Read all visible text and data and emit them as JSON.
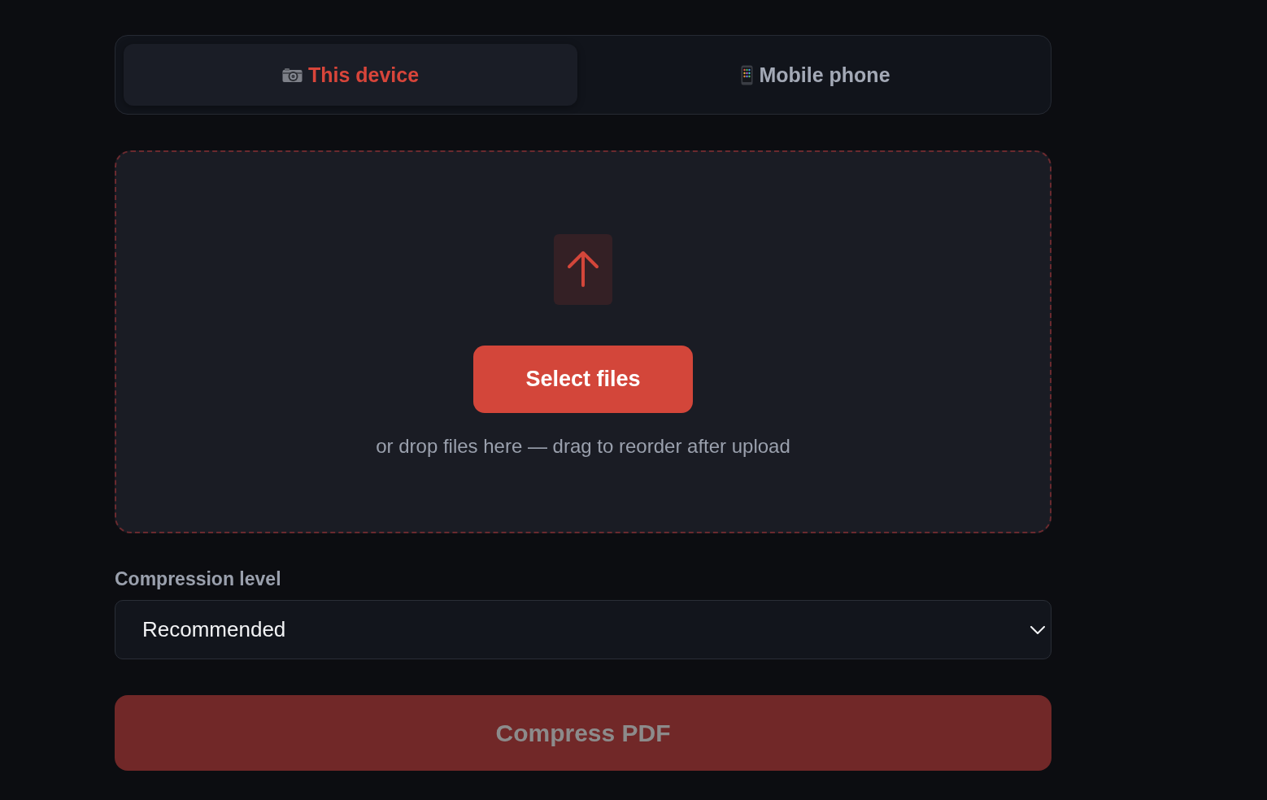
{
  "source_tabs": [
    {
      "label": "This device",
      "selected": true
    },
    {
      "label": "Mobile phone",
      "selected": false
    }
  ],
  "dropzone": {
    "button": "Select files",
    "hint": "or drop files here — drag to reorder after upload"
  },
  "compression_level": {
    "label": "Compression level",
    "value": "Recommended"
  },
  "compress_button": {
    "label": "Compress PDF",
    "disabled": true
  }
}
